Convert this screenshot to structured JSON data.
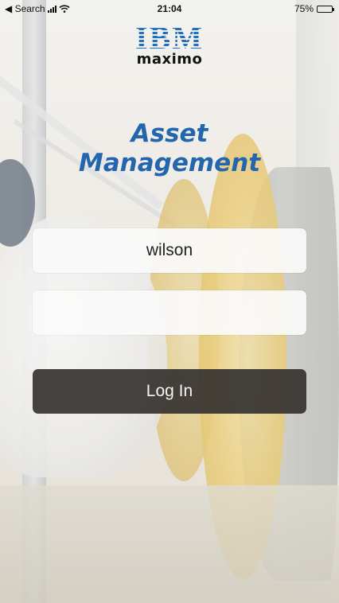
{
  "status_bar": {
    "back_label": "◀ Search",
    "time": "21:04",
    "battery_text": "75%",
    "battery_level": 0.75
  },
  "logo": {
    "brand": "IBM",
    "product": "maximo"
  },
  "title": {
    "line1": "Asset",
    "line2": "Management"
  },
  "form": {
    "username_value": "wilson",
    "password_value": "",
    "login_label": "Log In"
  },
  "colors": {
    "brand_blue": "#1f70c1",
    "title_blue": "#2466ad",
    "button_bg": "#373432"
  },
  "icons": [
    "signal-icon",
    "wifi-icon",
    "battery-icon"
  ]
}
